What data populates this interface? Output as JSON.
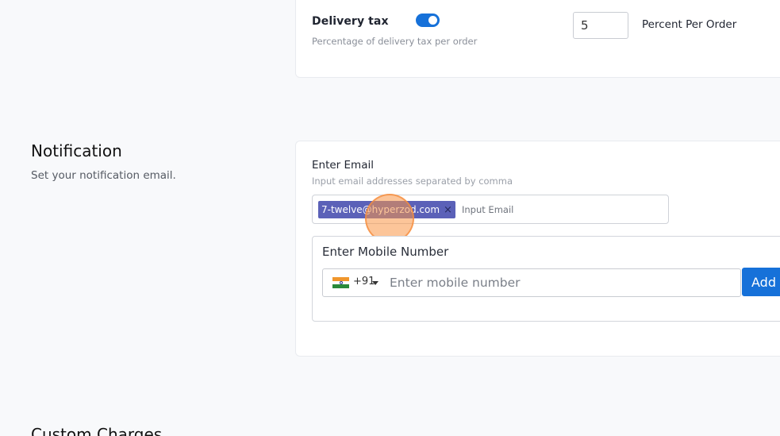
{
  "delivery_tax": {
    "title": "Delivery tax",
    "enabled": true,
    "description": "Percentage of delivery tax per order",
    "value": "5",
    "unit_label": "Percent Per Order"
  },
  "notification": {
    "title": "Notification",
    "subtitle": "Set your notification email.",
    "email": {
      "label": "Enter Email",
      "hint": "Input email addresses separated by comma",
      "chips": [
        "7-twelve@hyperzod.com"
      ],
      "placeholder": "Input Email"
    },
    "mobile": {
      "label": "Enter Mobile Number",
      "country_code": "+91",
      "country_flag": "india-flag-icon",
      "placeholder": "Enter mobile number",
      "add_label": "Add"
    }
  },
  "custom_charges": {
    "title": "Custom Charges"
  },
  "colors": {
    "accent": "#1671d9",
    "chip": "#5b61b8",
    "click_indicator": "#f5a05a"
  }
}
